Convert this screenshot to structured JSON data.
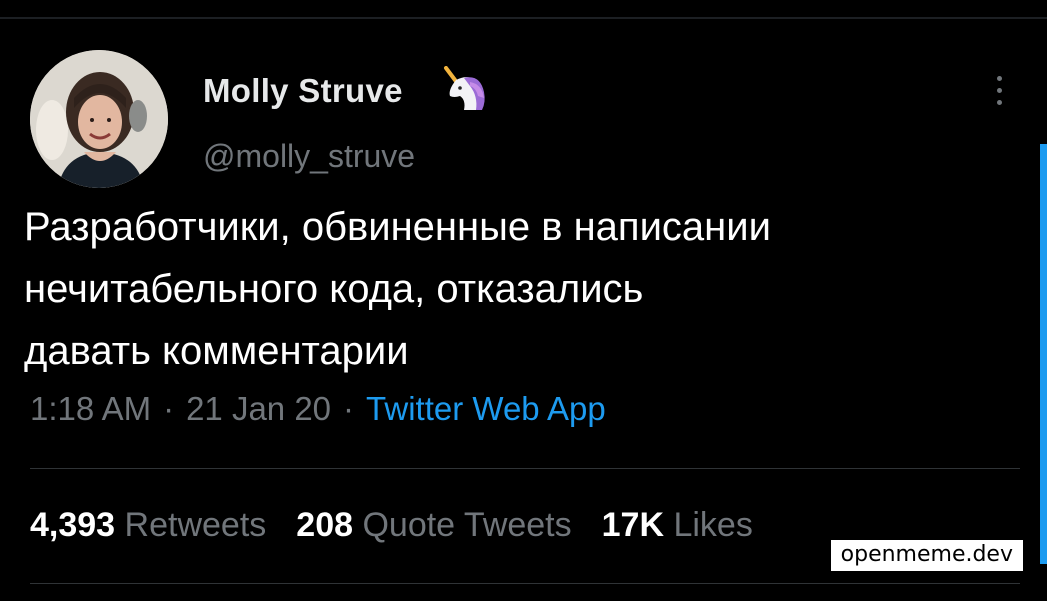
{
  "tweet": {
    "author": {
      "display_name": "Molly Struve",
      "handle": "@molly_struve",
      "name_icon": "unicorn-icon"
    },
    "text_lines": [
      "Разработчики, обвиненные в написании",
      "нечитабельного кода, отказались",
      "давать комментарии"
    ],
    "time": "1:18 AM",
    "date": "21 Jan 20",
    "separator": "·",
    "source": "Twitter Web App",
    "stats": {
      "retweets_count": "4,393",
      "retweets_label": "Retweets",
      "quotes_count": "208",
      "quotes_label": "Quote Tweets",
      "likes_count": "17K",
      "likes_label": "Likes"
    }
  },
  "watermark": "openmeme.dev",
  "colors": {
    "background": "#000000",
    "text_primary": "#ffffff",
    "text_secondary": "#71767b",
    "accent": "#1d9bf0",
    "divider": "#2f3336"
  }
}
